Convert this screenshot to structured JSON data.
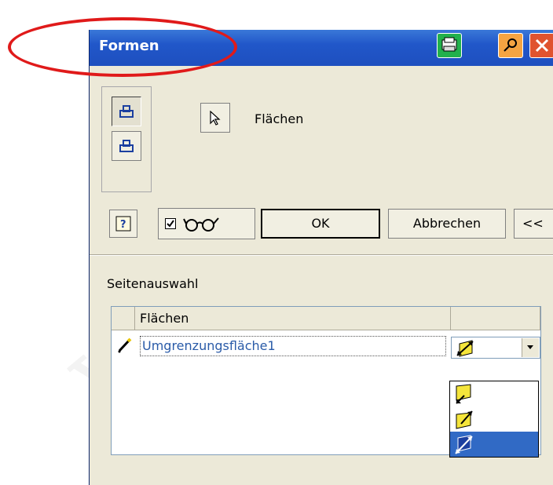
{
  "window": {
    "title": "Formen",
    "titlebar_color": "#2157c9"
  },
  "selection": {
    "faces_label": "Flächen"
  },
  "buttons": {
    "ok_label": "OK",
    "cancel_label": "Abbrechen",
    "more_label": "<<",
    "preview_checked": true
  },
  "section": {
    "label": "Seitenauswahl"
  },
  "table": {
    "columns": [
      "",
      "Flächen",
      ""
    ],
    "rows": [
      {
        "name": "Umgrenzungsfläche1",
        "direction_icon": "direction-both-icon"
      }
    ]
  },
  "dropdown": {
    "options": [
      {
        "icon": "direction-outward-icon",
        "selected": false
      },
      {
        "icon": "direction-inward-icon",
        "selected": false
      },
      {
        "icon": "direction-both-icon",
        "selected": true
      }
    ]
  },
  "colors": {
    "accent": "#316ac5",
    "annotation": "#e01a1a",
    "row_text": "#2a5ba8"
  }
}
